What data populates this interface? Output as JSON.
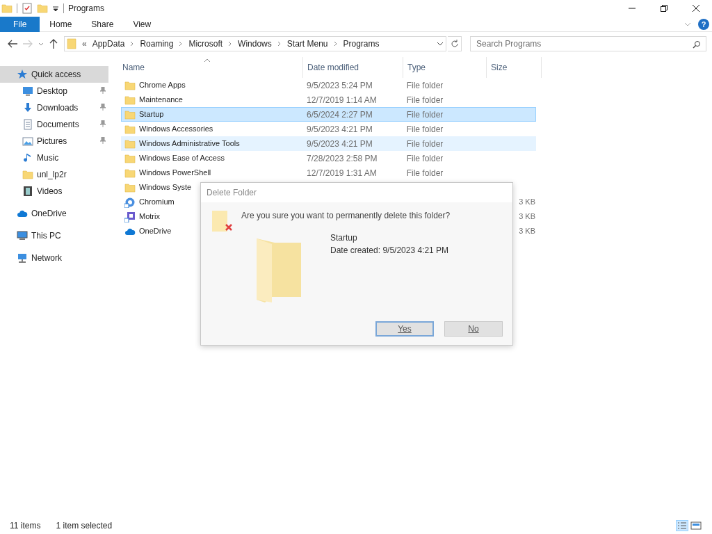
{
  "window": {
    "title": "Programs",
    "help": "?"
  },
  "ribbon_tabs": [
    {
      "label": "File",
      "selected": true
    },
    {
      "label": "Home",
      "selected": false
    },
    {
      "label": "Share",
      "selected": false
    },
    {
      "label": "View",
      "selected": false
    }
  ],
  "address": {
    "overflow": "«",
    "crumbs": [
      "AppData",
      "Roaming",
      "Microsoft",
      "Windows",
      "Start Menu",
      "Programs"
    ]
  },
  "search": {
    "placeholder": "Search Programs"
  },
  "sidebar": {
    "items": [
      {
        "label": "Quick access",
        "kind": "star",
        "selected": true,
        "children": [
          {
            "label": "Desktop",
            "kind": "desktop",
            "pinned": true
          },
          {
            "label": "Downloads",
            "kind": "download",
            "pinned": true
          },
          {
            "label": "Documents",
            "kind": "document",
            "pinned": true
          },
          {
            "label": "Pictures",
            "kind": "picture",
            "pinned": true
          },
          {
            "label": "Music",
            "kind": "music",
            "pinned": false
          },
          {
            "label": "unl_lp2r",
            "kind": "folder",
            "pinned": false
          },
          {
            "label": "Videos",
            "kind": "film",
            "pinned": false
          }
        ]
      },
      {
        "label": "OneDrive",
        "kind": "cloud",
        "selected": false
      },
      {
        "label": "This PC",
        "kind": "pc",
        "selected": false
      },
      {
        "label": "Network",
        "kind": "network",
        "selected": false
      }
    ]
  },
  "table": {
    "columns": [
      "Name",
      "Date modified",
      "Type",
      "Size"
    ],
    "rows": [
      {
        "kind": "folder",
        "name": "Chrome Apps",
        "date": "9/5/2023 5:24 PM",
        "type": "File folder",
        "selected": false,
        "hovered": false
      },
      {
        "kind": "folder",
        "name": "Maintenance",
        "date": "12/7/2019 1:14 AM",
        "type": "File folder",
        "selected": false,
        "hovered": false
      },
      {
        "kind": "folder",
        "name": "Startup",
        "date": "6/5/2024 2:27 PM",
        "type": "File folder",
        "selected": true,
        "hovered": false
      },
      {
        "kind": "folder",
        "name": "Windows Accessories",
        "date": "9/5/2023 4:21 PM",
        "type": "File folder",
        "selected": false,
        "hovered": false
      },
      {
        "kind": "folder",
        "name": "Windows Administrative Tools",
        "date": "9/5/2023 4:21 PM",
        "type": "File folder",
        "selected": false,
        "hovered": true
      },
      {
        "kind": "folder",
        "name": "Windows Ease of Access",
        "date": "7/28/2023 2:58 PM",
        "type": "File folder",
        "selected": false,
        "hovered": false
      },
      {
        "kind": "folder",
        "name": "Windows PowerShell",
        "date": "12/7/2019 1:31 AM",
        "type": "File folder",
        "selected": false,
        "hovered": false
      },
      {
        "kind": "folder",
        "name": "Windows Syste",
        "selected": false,
        "hovered": false
      },
      {
        "kind": "globe",
        "name": "Chromium",
        "size": "3 KB",
        "selected": false,
        "hovered": false
      },
      {
        "kind": "app",
        "name": "Motrix",
        "size": "3 KB",
        "selected": false,
        "hovered": false
      },
      {
        "kind": "cloud",
        "name": "OneDrive",
        "size": "3 KB",
        "selected": false,
        "hovered": false
      }
    ]
  },
  "dialog": {
    "title": "Delete Folder",
    "message": "Are you sure you want to permanently delete this folder?",
    "item_name": "Startup",
    "item_detail": "Date created: 9/5/2023 4:21 PM",
    "buttons": [
      {
        "label": "Yes",
        "default": true
      },
      {
        "label": "No",
        "default": false
      }
    ]
  },
  "status_bar": {
    "count": "11 items",
    "selection": "1 item selected"
  }
}
